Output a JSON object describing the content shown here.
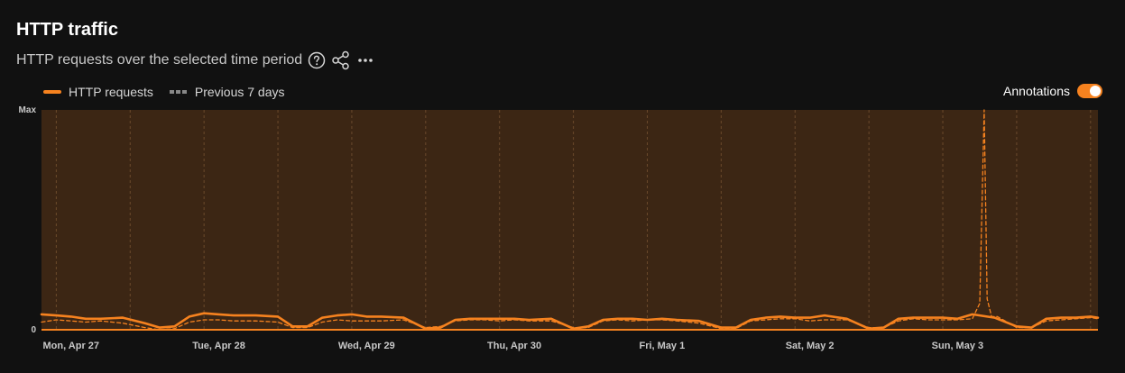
{
  "header": {
    "title": "HTTP traffic",
    "subtitle": "HTTP requests over the selected time period"
  },
  "icons": {
    "help": "question-circle-icon",
    "share": "share-icon",
    "more": "more-horizontal-icon"
  },
  "legend": {
    "current_label": "HTTP requests",
    "previous_label": "Previous 7 days"
  },
  "annotations": {
    "label": "Annotations",
    "enabled": true
  },
  "colors": {
    "accent": "#f6821f",
    "plot_bg": "#3c2614",
    "grid": "#6b4a2c",
    "previous": "#888888"
  },
  "chart_data": {
    "type": "line",
    "title": "HTTP traffic",
    "xlabel": "",
    "ylabel": "",
    "y_tick_labels": [
      "0",
      "Max"
    ],
    "ylim": [
      0,
      100
    ],
    "x_tick_labels": [
      "Mon, Apr 27",
      "Tue, Apr 28",
      "Wed, Apr 29",
      "Thu, Apr 30",
      "Fri, May 1",
      "Sat, May 2",
      "Sun, May 3"
    ],
    "x_range_days": [
      -0.1,
      7.05
    ],
    "grid": true,
    "legend_position": "top-left",
    "series": [
      {
        "name": "HTTP requests",
        "style": "solid",
        "x": [
          -0.1,
          0.0,
          0.1,
          0.2,
          0.3,
          0.45,
          0.6,
          0.7,
          0.8,
          0.9,
          1.0,
          1.1,
          1.2,
          1.35,
          1.5,
          1.6,
          1.7,
          1.8,
          1.9,
          2.0,
          2.1,
          2.2,
          2.35,
          2.5,
          2.6,
          2.7,
          2.8,
          2.9,
          3.0,
          3.1,
          3.2,
          3.35,
          3.5,
          3.6,
          3.7,
          3.8,
          3.9,
          4.0,
          4.1,
          4.2,
          4.35,
          4.5,
          4.6,
          4.7,
          4.8,
          4.9,
          5.0,
          5.1,
          5.2,
          5.35,
          5.5,
          5.6,
          5.7,
          5.8,
          5.9,
          6.0,
          6.1,
          6.2,
          6.35,
          6.5,
          6.6,
          6.7,
          6.8,
          6.9,
          7.0,
          7.05
        ],
        "y": [
          7,
          6.5,
          6,
          5,
          5,
          5.5,
          3,
          1,
          1.5,
          6,
          7.5,
          7,
          6.5,
          6.5,
          6,
          1.5,
          1.5,
          5.5,
          6.5,
          7,
          6,
          6,
          5.5,
          0.5,
          1,
          4.5,
          5,
          5,
          5,
          5,
          4.5,
          5,
          0.5,
          1.5,
          4.5,
          5,
          5,
          4.5,
          5,
          4.5,
          4,
          1,
          1,
          4.5,
          5.5,
          6,
          5.5,
          5.5,
          6.5,
          5,
          0.5,
          1,
          5,
          5.5,
          5.5,
          5.5,
          5,
          7,
          5.5,
          1.5,
          1,
          5,
          5.5,
          5.5,
          6,
          5.5
        ]
      },
      {
        "name": "Previous 7 days",
        "style": "dashed",
        "x": [
          -0.1,
          0.0,
          0.1,
          0.2,
          0.3,
          0.45,
          0.6,
          0.7,
          0.8,
          0.9,
          1.0,
          1.1,
          1.2,
          1.35,
          1.5,
          1.6,
          1.7,
          1.8,
          1.9,
          2.0,
          2.1,
          2.2,
          2.35,
          2.5,
          2.6,
          2.7,
          2.8,
          2.9,
          3.0,
          3.1,
          3.2,
          3.35,
          3.5,
          3.6,
          3.7,
          3.8,
          3.9,
          4.0,
          4.1,
          4.2,
          4.35,
          4.5,
          4.6,
          4.7,
          4.8,
          4.9,
          5.0,
          5.1,
          5.2,
          5.35,
          5.5,
          5.6,
          5.7,
          5.8,
          5.9,
          6.0,
          6.1,
          6.2,
          6.25,
          6.28,
          6.3,
          6.33,
          6.37,
          6.5,
          6.6,
          6.7,
          6.8,
          6.9,
          7.0,
          7.05
        ],
        "y": [
          3.5,
          4.5,
          4,
          3.5,
          4,
          3,
          1,
          0,
          0.5,
          3.5,
          4.5,
          4.5,
          4,
          4,
          3.5,
          1,
          1,
          3.5,
          4.5,
          4,
          4,
          4,
          4.5,
          1,
          1.5,
          4,
          4.5,
          4.5,
          4,
          4.5,
          4,
          4,
          1,
          1,
          4,
          4.5,
          4,
          4.5,
          4.5,
          4,
          3,
          0.5,
          0.5,
          4,
          4.5,
          5,
          5,
          4,
          4.5,
          4.5,
          1,
          1,
          4,
          5,
          4.5,
          4.5,
          4.5,
          5,
          12,
          100,
          14,
          6,
          6,
          1,
          1,
          4,
          4.5,
          5,
          5.5,
          5
        ]
      }
    ]
  }
}
